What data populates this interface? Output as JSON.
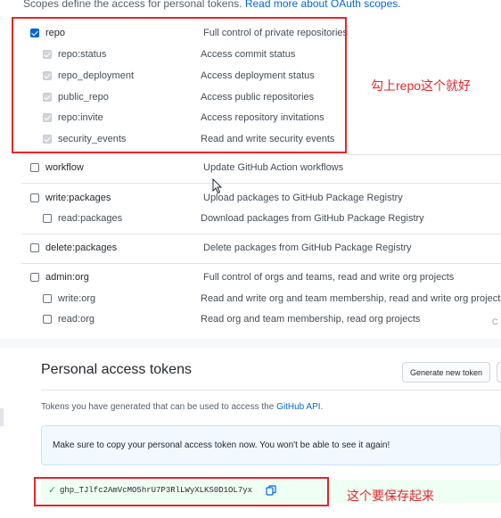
{
  "header": {
    "intro_text": "Scopes define the access for personal tokens.",
    "intro_link": "Read more about OAuth scopes."
  },
  "scopes": {
    "repo": {
      "name": "repo",
      "desc": "Full control of private repositories",
      "checked": true
    },
    "repo_children": [
      {
        "name": "repo:status",
        "desc": "Access commit status",
        "checked": true
      },
      {
        "name": "repo_deployment",
        "desc": "Access deployment status",
        "checked": true
      },
      {
        "name": "public_repo",
        "desc": "Access public repositories",
        "checked": true
      },
      {
        "name": "repo:invite",
        "desc": "Access repository invitations",
        "checked": true
      },
      {
        "name": "security_events",
        "desc": "Read and write security events",
        "checked": true
      }
    ],
    "workflow": {
      "name": "workflow",
      "desc": "Update GitHub Action workflows",
      "checked": false
    },
    "write_packages": {
      "name": "write:packages",
      "desc": "Upload packages to GitHub Package Registry",
      "checked": false
    },
    "read_packages": {
      "name": "read:packages",
      "desc": "Download packages from GitHub Package Registry",
      "checked": false
    },
    "delete_packages": {
      "name": "delete:packages",
      "desc": "Delete packages from GitHub Package Registry",
      "checked": false
    },
    "admin_org": {
      "name": "admin:org",
      "desc": "Full control of orgs and teams, read and write org projects",
      "checked": false
    },
    "write_org": {
      "name": "write:org",
      "desc": "Read and write org and team membership, read and write org projects",
      "checked": false
    },
    "read_org": {
      "name": "read:org",
      "desc": "Read org and team membership, read org projects",
      "checked": false
    }
  },
  "annotations": {
    "repo_note": "勾上repo这个就好",
    "token_note": "这个要保存起来"
  },
  "pat": {
    "title": "Personal access tokens",
    "generate_button": "Generate new token",
    "desc_text": "Tokens you have generated that can be used to access the",
    "desc_link": "GitHub API",
    "desc_end": ".",
    "notice": "Make sure to copy your personal access token now. You won't be able to see it again!",
    "token_check": "✓",
    "token_value": "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"
  },
  "edge_text": "C",
  "colors": {
    "accent": "#0366d6",
    "annotation_red": "#e5252b",
    "success_green": "#28a745",
    "notice_bg": "#f1f8ff"
  },
  "icons": [
    "checkbox-icon",
    "copy-icon",
    "check-icon",
    "mouse-cursor-icon"
  ]
}
